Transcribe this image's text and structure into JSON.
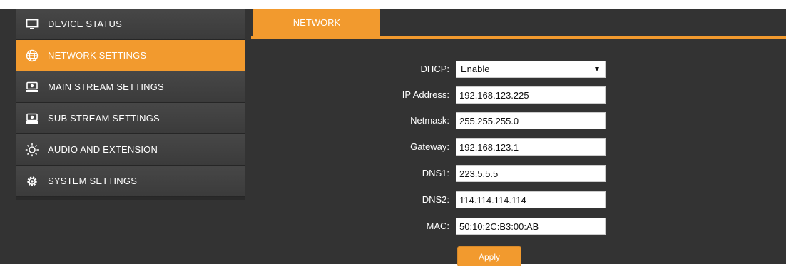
{
  "sidebar": {
    "items": [
      {
        "label": "DEVICE STATUS",
        "icon": "monitor-icon",
        "active": false
      },
      {
        "label": "NETWORK SETTINGS",
        "icon": "globe-icon",
        "active": true
      },
      {
        "label": "MAIN STREAM SETTINGS",
        "icon": "hard-drive-icon",
        "active": false
      },
      {
        "label": "SUB STREAM SETTINGS",
        "icon": "hard-drive-icon",
        "active": false
      },
      {
        "label": "AUDIO AND EXTENSION",
        "icon": "sun-icon",
        "active": false
      },
      {
        "label": "SYSTEM SETTINGS",
        "icon": "gear-icon",
        "active": false
      }
    ]
  },
  "tabs": [
    {
      "label": "NETWORK",
      "active": true
    }
  ],
  "form": {
    "dhcp": {
      "label": "DHCP:",
      "value": "Enable"
    },
    "ip": {
      "label": "IP Address:",
      "value": "192.168.123.225"
    },
    "netmask": {
      "label": "Netmask:",
      "value": "255.255.255.0"
    },
    "gateway": {
      "label": "Gateway:",
      "value": "192.168.123.1"
    },
    "dns1": {
      "label": "DNS1:",
      "value": "223.5.5.5"
    },
    "dns2": {
      "label": "DNS2:",
      "value": "114.114.114.114"
    },
    "mac": {
      "label": "MAC:",
      "value": "50:10:2C:B3:00:AB"
    },
    "apply_label": "Apply"
  },
  "colors": {
    "accent": "#f29a2e",
    "background": "#333333",
    "menu_bg": "#424242"
  }
}
